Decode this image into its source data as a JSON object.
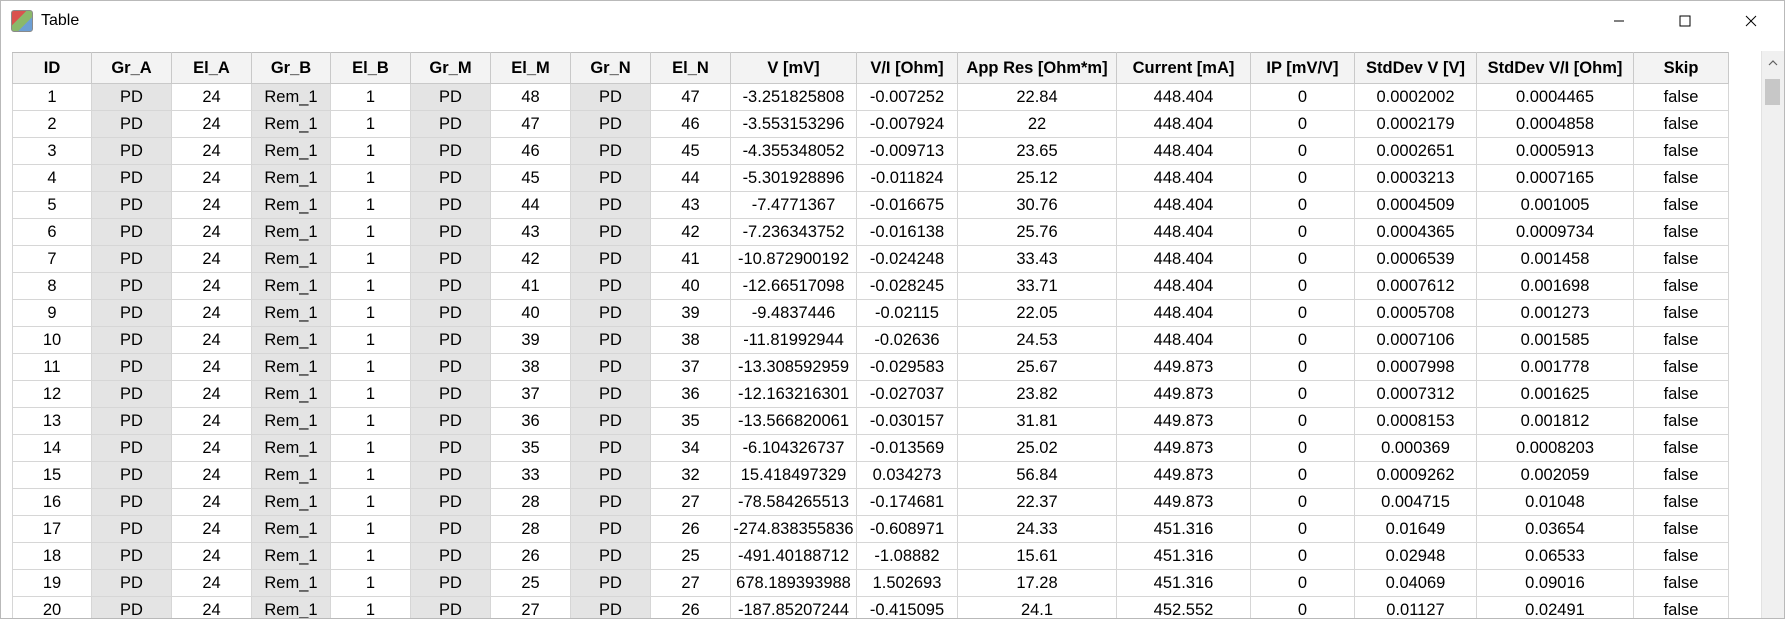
{
  "window": {
    "title": "Table"
  },
  "columns": [
    "ID",
    "Gr_A",
    "El_A",
    "Gr_B",
    "El_B",
    "Gr_M",
    "El_M",
    "Gr_N",
    "El_N",
    "V [mV]",
    "V/I [Ohm]",
    "App Res [Ohm*m]",
    "Current [mA]",
    "IP [mV/V]",
    "StdDev V [V]",
    "StdDev V/I [Ohm]",
    "Skip"
  ],
  "rows": [
    [
      "1",
      "PD",
      "24",
      "Rem_1",
      "1",
      "PD",
      "48",
      "PD",
      "47",
      "-3.251825808",
      "-0.007252",
      "22.84",
      "448.404",
      "0",
      "0.0002002",
      "0.0004465",
      "false"
    ],
    [
      "2",
      "PD",
      "24",
      "Rem_1",
      "1",
      "PD",
      "47",
      "PD",
      "46",
      "-3.553153296",
      "-0.007924",
      "22",
      "448.404",
      "0",
      "0.0002179",
      "0.0004858",
      "false"
    ],
    [
      "3",
      "PD",
      "24",
      "Rem_1",
      "1",
      "PD",
      "46",
      "PD",
      "45",
      "-4.355348052",
      "-0.009713",
      "23.65",
      "448.404",
      "0",
      "0.0002651",
      "0.0005913",
      "false"
    ],
    [
      "4",
      "PD",
      "24",
      "Rem_1",
      "1",
      "PD",
      "45",
      "PD",
      "44",
      "-5.301928896",
      "-0.011824",
      "25.12",
      "448.404",
      "0",
      "0.0003213",
      "0.0007165",
      "false"
    ],
    [
      "5",
      "PD",
      "24",
      "Rem_1",
      "1",
      "PD",
      "44",
      "PD",
      "43",
      "-7.4771367",
      "-0.016675",
      "30.76",
      "448.404",
      "0",
      "0.0004509",
      "0.001005",
      "false"
    ],
    [
      "6",
      "PD",
      "24",
      "Rem_1",
      "1",
      "PD",
      "43",
      "PD",
      "42",
      "-7.236343752",
      "-0.016138",
      "25.76",
      "448.404",
      "0",
      "0.0004365",
      "0.0009734",
      "false"
    ],
    [
      "7",
      "PD",
      "24",
      "Rem_1",
      "1",
      "PD",
      "42",
      "PD",
      "41",
      "-10.872900192",
      "-0.024248",
      "33.43",
      "448.404",
      "0",
      "0.0006539",
      "0.001458",
      "false"
    ],
    [
      "8",
      "PD",
      "24",
      "Rem_1",
      "1",
      "PD",
      "41",
      "PD",
      "40",
      "-12.66517098",
      "-0.028245",
      "33.71",
      "448.404",
      "0",
      "0.0007612",
      "0.001698",
      "false"
    ],
    [
      "9",
      "PD",
      "24",
      "Rem_1",
      "1",
      "PD",
      "40",
      "PD",
      "39",
      "-9.4837446",
      "-0.02115",
      "22.05",
      "448.404",
      "0",
      "0.0005708",
      "0.001273",
      "false"
    ],
    [
      "10",
      "PD",
      "24",
      "Rem_1",
      "1",
      "PD",
      "39",
      "PD",
      "38",
      "-11.81992944",
      "-0.02636",
      "24.53",
      "448.404",
      "0",
      "0.0007106",
      "0.001585",
      "false"
    ],
    [
      "11",
      "PD",
      "24",
      "Rem_1",
      "1",
      "PD",
      "38",
      "PD",
      "37",
      "-13.308592959",
      "-0.029583",
      "25.67",
      "449.873",
      "0",
      "0.0007998",
      "0.001778",
      "false"
    ],
    [
      "12",
      "PD",
      "24",
      "Rem_1",
      "1",
      "PD",
      "37",
      "PD",
      "36",
      "-12.163216301",
      "-0.027037",
      "23.82",
      "449.873",
      "0",
      "0.0007312",
      "0.001625",
      "false"
    ],
    [
      "13",
      "PD",
      "24",
      "Rem_1",
      "1",
      "PD",
      "36",
      "PD",
      "35",
      "-13.566820061",
      "-0.030157",
      "31.81",
      "449.873",
      "0",
      "0.0008153",
      "0.001812",
      "false"
    ],
    [
      "14",
      "PD",
      "24",
      "Rem_1",
      "1",
      "PD",
      "35",
      "PD",
      "34",
      "-6.104326737",
      "-0.013569",
      "25.02",
      "449.873",
      "0",
      "0.000369",
      "0.0008203",
      "false"
    ],
    [
      "15",
      "PD",
      "24",
      "Rem_1",
      "1",
      "PD",
      "33",
      "PD",
      "32",
      "15.418497329",
      "0.034273",
      "56.84",
      "449.873",
      "0",
      "0.0009262",
      "0.002059",
      "false"
    ],
    [
      "16",
      "PD",
      "24",
      "Rem_1",
      "1",
      "PD",
      "28",
      "PD",
      "27",
      "-78.584265513",
      "-0.174681",
      "22.37",
      "449.873",
      "0",
      "0.004715",
      "0.01048",
      "false"
    ],
    [
      "17",
      "PD",
      "24",
      "Rem_1",
      "1",
      "PD",
      "28",
      "PD",
      "26",
      "-274.838355836",
      "-0.608971",
      "24.33",
      "451.316",
      "0",
      "0.01649",
      "0.03654",
      "false"
    ],
    [
      "18",
      "PD",
      "24",
      "Rem_1",
      "1",
      "PD",
      "26",
      "PD",
      "25",
      "-491.40188712",
      "-1.08882",
      "15.61",
      "451.316",
      "0",
      "0.02948",
      "0.06533",
      "false"
    ],
    [
      "19",
      "PD",
      "24",
      "Rem_1",
      "1",
      "PD",
      "25",
      "PD",
      "27",
      "678.189393988",
      "1.502693",
      "17.28",
      "451.316",
      "0",
      "0.04069",
      "0.09016",
      "false"
    ],
    [
      "20",
      "PD",
      "24",
      "Rem_1",
      "1",
      "PD",
      "27",
      "PD",
      "26",
      "-187.85207244",
      "-0.415095",
      "24.1",
      "452.552",
      "0",
      "0.01127",
      "0.02491",
      "false"
    ]
  ]
}
